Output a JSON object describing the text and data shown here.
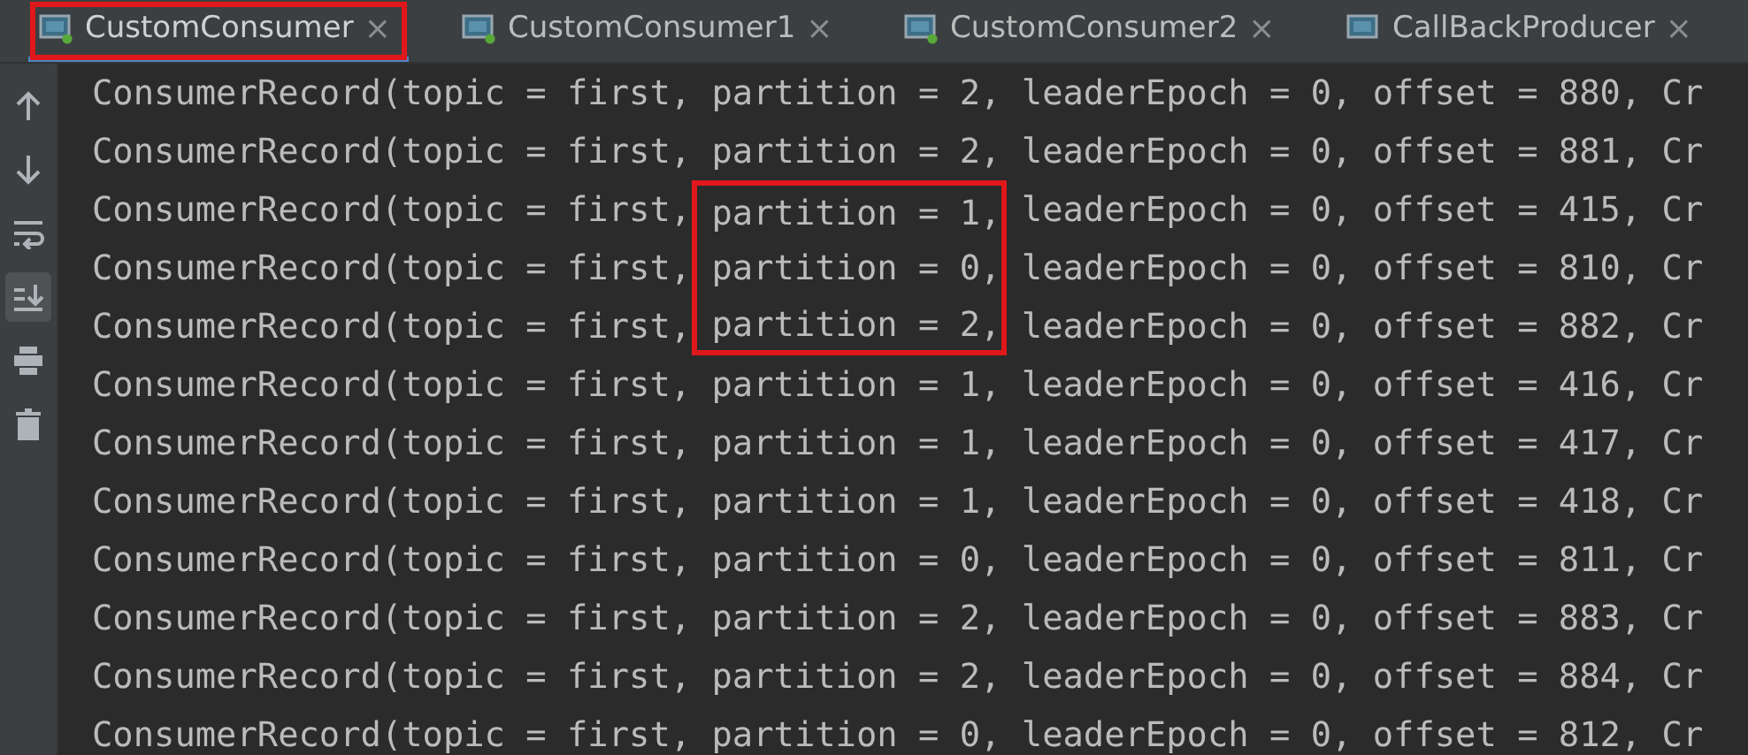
{
  "tabs": [
    {
      "label": "CustomConsumer",
      "selected": true,
      "running": true,
      "highlighted": true,
      "close": "×"
    },
    {
      "label": "CustomConsumer1",
      "selected": false,
      "running": true,
      "highlighted": false,
      "close": "×"
    },
    {
      "label": "CustomConsumer2",
      "selected": false,
      "running": true,
      "highlighted": false,
      "close": "×"
    },
    {
      "label": "CallBackProducer",
      "selected": false,
      "running": false,
      "highlighted": false,
      "close": "×"
    }
  ],
  "toolbar": [
    {
      "kind": "up",
      "selected": false
    },
    {
      "kind": "down",
      "selected": false
    },
    {
      "kind": "wrap",
      "selected": false
    },
    {
      "kind": "scroll-end",
      "selected": true
    },
    {
      "kind": "print",
      "selected": false
    },
    {
      "kind": "trash",
      "selected": false
    }
  ],
  "console_lines": [
    {
      "start": "ConsumerRecord(topic = first,",
      "partition": "partition = 2,",
      "end": "leaderEpoch = 0, offset = 880, Cr",
      "highlighted": false
    },
    {
      "start": "ConsumerRecord(topic = first,",
      "partition": "partition = 2,",
      "end": "leaderEpoch = 0, offset = 881, Cr",
      "highlighted": false
    },
    {
      "start": "ConsumerRecord(topic = first,",
      "partition": "partition = 1,",
      "end": "leaderEpoch = 0, offset = 415, Cr",
      "highlighted": true
    },
    {
      "start": "ConsumerRecord(topic = first,",
      "partition": "partition = 0,",
      "end": "leaderEpoch = 0, offset = 810, Cr",
      "highlighted": true
    },
    {
      "start": "ConsumerRecord(topic = first,",
      "partition": "partition = 2,",
      "end": "leaderEpoch = 0, offset = 882, Cr",
      "highlighted": true
    },
    {
      "start": "ConsumerRecord(topic = first,",
      "partition": "partition = 1,",
      "end": "leaderEpoch = 0, offset = 416, Cr",
      "highlighted": false
    },
    {
      "start": "ConsumerRecord(topic = first,",
      "partition": "partition = 1,",
      "end": "leaderEpoch = 0, offset = 417, Cr",
      "highlighted": false
    },
    {
      "start": "ConsumerRecord(topic = first,",
      "partition": "partition = 1,",
      "end": "leaderEpoch = 0, offset = 418, Cr",
      "highlighted": false
    },
    {
      "start": "ConsumerRecord(topic = first,",
      "partition": "partition = 0,",
      "end": "leaderEpoch = 0, offset = 811, Cr",
      "highlighted": false
    },
    {
      "start": "ConsumerRecord(topic = first,",
      "partition": "partition = 2,",
      "end": "leaderEpoch = 0, offset = 883, Cr",
      "highlighted": false
    },
    {
      "start": "ConsumerRecord(topic = first,",
      "partition": "partition = 2,",
      "end": "leaderEpoch = 0, offset = 884, Cr",
      "highlighted": false
    },
    {
      "start": "ConsumerRecord(topic = first,",
      "partition": "partition = 0,",
      "end": "leaderEpoch = 0, offset = 812, Cr",
      "highlighted": false
    }
  ]
}
